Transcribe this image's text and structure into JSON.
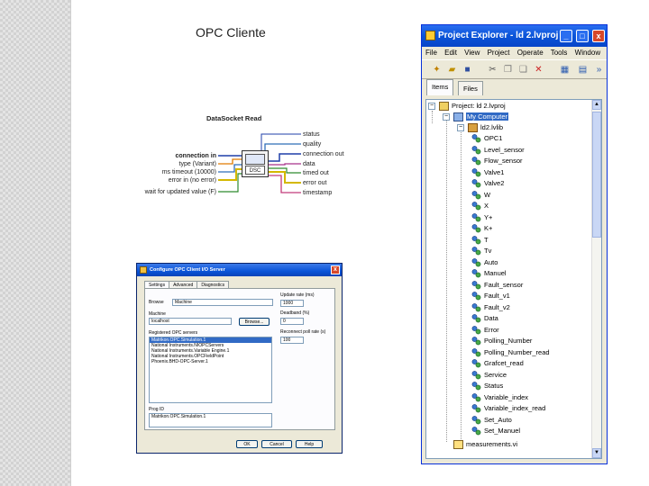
{
  "slide": {
    "title": "OPC Cliente"
  },
  "datasocket": {
    "title": "DataSocket Read",
    "inputs": [
      "connection in",
      "type (Variant)",
      "ms timeout (10000)",
      "error in (no error)",
      "wait for updated value (F)"
    ],
    "outputs": [
      "status",
      "quality",
      "connection out",
      "data",
      "timed out",
      "error out",
      "timestamp"
    ],
    "node_label": "DSC"
  },
  "opc_dialog": {
    "title": "Configure OPC Client I/O Server",
    "close_label": "x",
    "tabs": [
      "Settings",
      "Advanced",
      "Diagnostics"
    ],
    "browse_label": "Browse",
    "browse_value": "Machine",
    "machine_label": "Machine",
    "machine_value": "localhost",
    "browse_button": "Browse...",
    "registered_label": "Registered OPC servers",
    "servers": [
      "Matrikon.OPC.Simulation.1",
      "National Instruments.NIOPCServers",
      "National Instruments.Variable Engine.1",
      "National Instruments.OPCFieldPoint",
      "Phoenix.BHD-OPC-Server.1"
    ],
    "update_rate_label": "Update rate (ms)",
    "update_rate_value": "1000",
    "deadband_label": "Deadband (%)",
    "deadband_value": "0",
    "retry_label": "Reconnect poll rate (s)",
    "retry_value": "100",
    "progid_label": "Prog ID",
    "progid_value": "Matrikon.OPC.Simulation.1",
    "ok_label": "OK",
    "cancel_label": "Cancel",
    "help_label": "Help"
  },
  "project_explorer": {
    "title": "Project Explorer - ld 2.lvproj",
    "menu": [
      "File",
      "Edit",
      "View",
      "Project",
      "Operate",
      "Tools",
      "Window"
    ],
    "tabs": [
      "Items",
      "Files"
    ],
    "project_root": "Project: ld 2.lvproj",
    "computer": "My Computer",
    "library": "ld2.lvlib",
    "variables": [
      "OPC1",
      "Level_sensor",
      "Flow_sensor",
      "Valve1",
      "Valve2",
      "W",
      "X",
      "Y+",
      "K+",
      "T",
      "Tv",
      "Auto",
      "Manuel",
      "Fault_sensor",
      "Fault_v1",
      "Fault_v2",
      "Data",
      "Error",
      "Polling_Number",
      "Polling_Number_read",
      "Grafcet_read",
      "Service",
      "Status",
      "Variable_index",
      "Variable_index_read",
      "Set_Auto",
      "Set_Manuel"
    ],
    "last_item": "measurements.vi",
    "window_buttons": [
      "_",
      "□",
      "x"
    ]
  }
}
